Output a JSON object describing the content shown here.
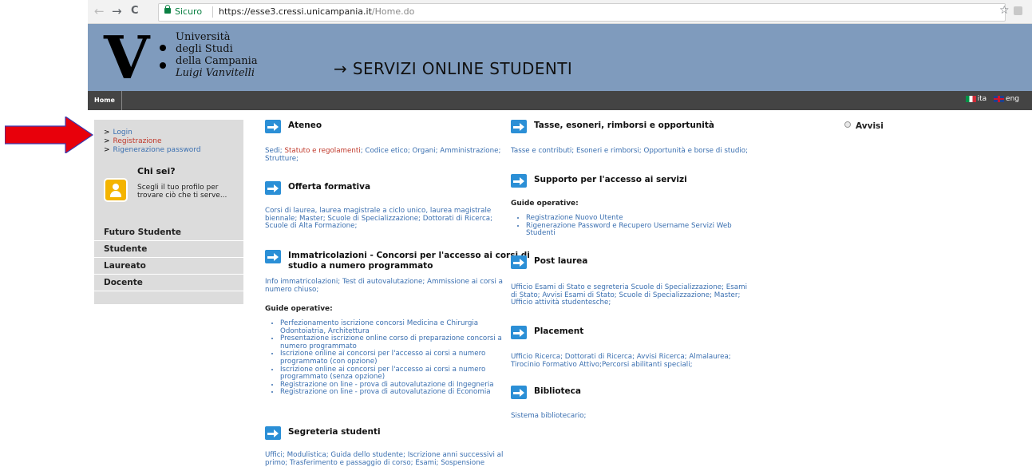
{
  "browser": {
    "back": "←",
    "forward": "→",
    "reload": "C",
    "secure_label": "Sicuro",
    "url_host": "https://esse3.cressi.unicampania.it",
    "url_path": "/Home.do",
    "star": "☆",
    "menu": "⋮"
  },
  "header": {
    "logo_letter": "V",
    "logo_line1": "Università",
    "logo_line2": "degli Studi",
    "logo_line3": "della Campania",
    "logo_line4": "Luigi Vanvitelli",
    "title": "→ SERVIZI ONLINE STUDENTI"
  },
  "topnav": {
    "home": "Home",
    "lang_it": "ita",
    "lang_en": "eng"
  },
  "sidebar": {
    "links": [
      "Login",
      "Registrazione",
      "Rigenerazione password"
    ],
    "chi_sei": "Chi sei?",
    "profile_text": "Scegli il tuo profilo per trovare ciò che ti serve...",
    "menu": [
      "Futuro Studente",
      "Studente",
      "Laureato",
      "Docente"
    ]
  },
  "ateneo": {
    "title": "Ateneo",
    "links": [
      "Sedi",
      "Statuto e regolamenti",
      "Codice etico",
      "Organi",
      "Amministrazione",
      "Strutture"
    ]
  },
  "offerta": {
    "title": "Offerta formativa",
    "text": "Corsi di laurea, laurea magistrale a ciclo unico, laurea magistrale biennale; Master; Scuole di Specializzazione; Dottorati di Ricerca; Scuole di Alta Formazione;"
  },
  "immatricolazioni": {
    "title_line1": "Immatricolazioni - Concorsi per l'accesso ai corsi di",
    "title_line2": "studio a numero programmato",
    "text": "Info immatricolazioni; Test di autovalutazione; Ammissione ai corsi a numero chiuso;",
    "guide_label": "Guide operative:",
    "guides": [
      "Perfezionamento iscrizione concorsi Medicina e Chirurgia Odontoiatria, Architettura",
      "Presentazione iscrizione online corso di preparazione concorsi a numero programmato",
      "Iscrizione online ai concorsi per l'accesso ai corsi a numero programmato (con opzione)",
      "Iscrizione online ai concorsi per l'accesso ai corsi a numero programmato (senza opzione)",
      "Registrazione on line - prova di autovalutazione di Ingegneria",
      "Registrazione on line - prova di autovalutazione di Economia"
    ]
  },
  "segreteria": {
    "title": "Segreteria studenti",
    "text": "Uffici; Modulistica; Guida dello studente; Iscrizione anni successivi al primo; Trasferimento e passaggio di corso; Esami; Sospensione"
  },
  "tasse": {
    "title": "Tasse, esoneri, rimborsi e opportunità",
    "text": "Tasse e contributi; Esoneri e rimborsi; Opportunità e borse di studio;"
  },
  "supporto": {
    "title": "Supporto per l'accesso ai servizi",
    "guide_label": "Guide operative:",
    "guides": [
      "Registrazione Nuovo Utente",
      "Rigenerazione Password e Recupero Username Servizi Web Studenti"
    ]
  },
  "postlaurea": {
    "title": "Post laurea",
    "text": "Ufficio Esami di Stato e segreteria Scuole di Specializzazione; Esami di Stato; Avvisi Esami di Stato; Scuole di Specializzazione; Master; Ufficio attività studentesche;"
  },
  "placement": {
    "title": "Placement",
    "text": "Ufficio Ricerca; Dottorati di Ricerca; Avvisi Ricerca; Almalaurea; Tirocinio Formativo Attivo;Percorsi abilitanti speciali;"
  },
  "biblioteca": {
    "title": "Biblioteca",
    "text": "Sistema bibliotecario;"
  },
  "avvisi": {
    "title": "Avvisi"
  },
  "colors": {
    "banner": "#7f9bbd",
    "nav": "#444444",
    "link": "#3a6fb0",
    "icon": "#2b8fd6",
    "annotation_arrow": "#e8000b"
  }
}
